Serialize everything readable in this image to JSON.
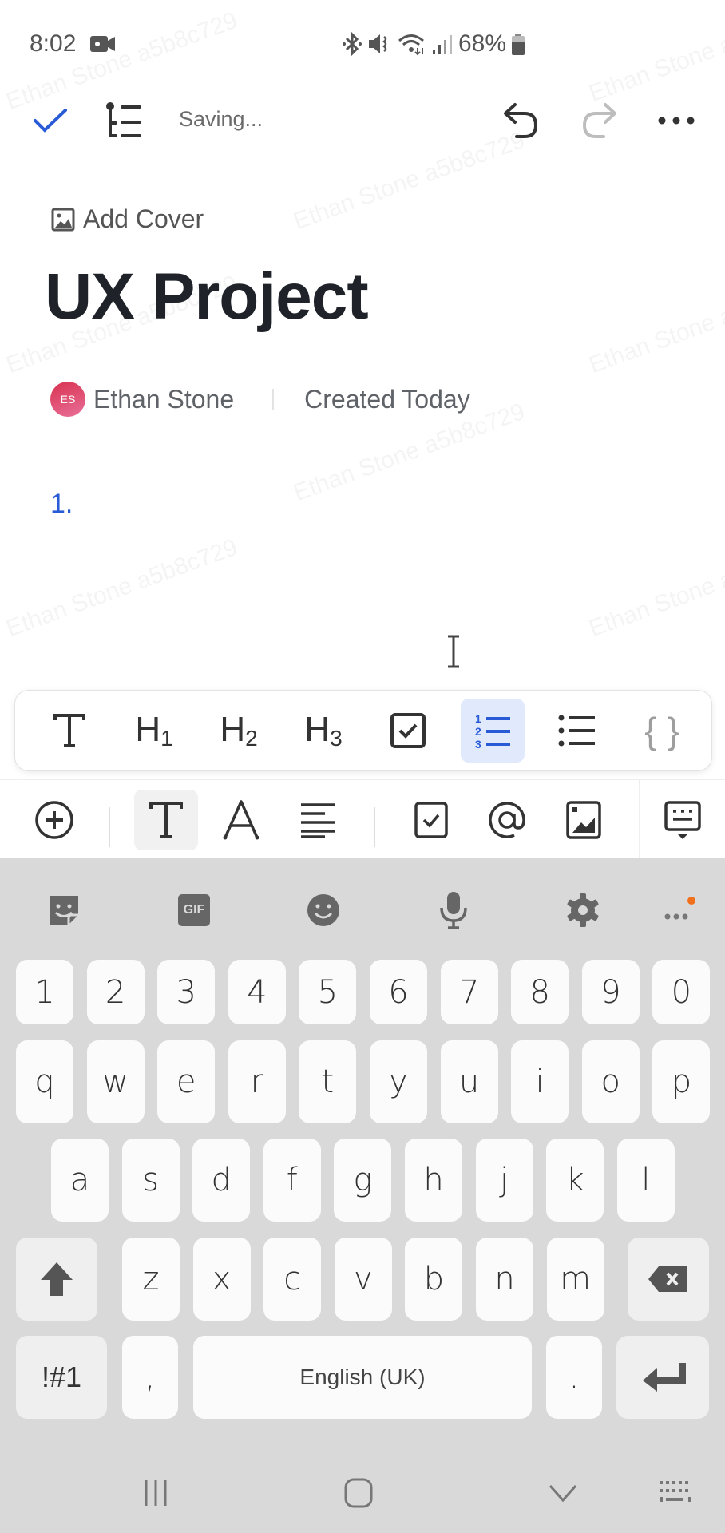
{
  "status_bar": {
    "time": "8:02",
    "battery": "68%",
    "icons": [
      "video-record-icon",
      "bluetooth-icon",
      "mute-icon",
      "wifi-icon",
      "signal-icon",
      "battery-icon"
    ]
  },
  "header": {
    "done_icon": "check-icon",
    "outline_icon": "outline-icon",
    "status_text": "Saving...",
    "undo_icon": "undo-icon",
    "redo_icon": "redo-icon",
    "more_icon": "more-icon"
  },
  "document": {
    "add_cover_label": "Add Cover",
    "title": "UX Project",
    "author_initials": "ES",
    "author_name": "Ethan Stone",
    "created_label": "Created Today",
    "list_marker": "1."
  },
  "block_toolbar": {
    "items": [
      {
        "name": "text",
        "label": "T"
      },
      {
        "name": "heading-1",
        "label": "H",
        "sub": "1"
      },
      {
        "name": "heading-2",
        "label": "H",
        "sub": "2"
      },
      {
        "name": "heading-3",
        "label": "H",
        "sub": "3"
      },
      {
        "name": "checkbox",
        "label": ""
      },
      {
        "name": "numbered-list",
        "label": "",
        "active": true
      },
      {
        "name": "bulleted-list",
        "label": ""
      },
      {
        "name": "code-block",
        "label": "{ }"
      }
    ]
  },
  "format_toolbar": {
    "items": [
      "insert",
      "text-style",
      "font",
      "align",
      "task",
      "mention",
      "image",
      "keyboard-toggle"
    ],
    "text_label": "T",
    "font_label": "A"
  },
  "keyboard": {
    "toolbar": [
      "sticker-icon",
      "gif-icon",
      "emoji-icon",
      "mic-icon",
      "settings-icon",
      "more-icon"
    ],
    "gif_label": "GIF",
    "row_numbers": [
      "1",
      "2",
      "3",
      "4",
      "5",
      "6",
      "7",
      "8",
      "9",
      "0"
    ],
    "row_1": [
      "q",
      "w",
      "e",
      "r",
      "t",
      "y",
      "u",
      "i",
      "o",
      "p"
    ],
    "row_2": [
      "a",
      "s",
      "d",
      "f",
      "g",
      "h",
      "j",
      "k",
      "l"
    ],
    "row_3": [
      "z",
      "x",
      "c",
      "v",
      "b",
      "n",
      "m"
    ],
    "symbols_label": "!#1",
    "comma_label": ",",
    "space_label": "English (UK)",
    "period_label": ".",
    "notification_color": "#f0701e"
  },
  "watermark": "Ethan Stone a5b8c729",
  "colors": {
    "accent": "#2a5bd7",
    "active_bg": "#e0eafc",
    "keyboard_bg": "#d9d9d9"
  }
}
